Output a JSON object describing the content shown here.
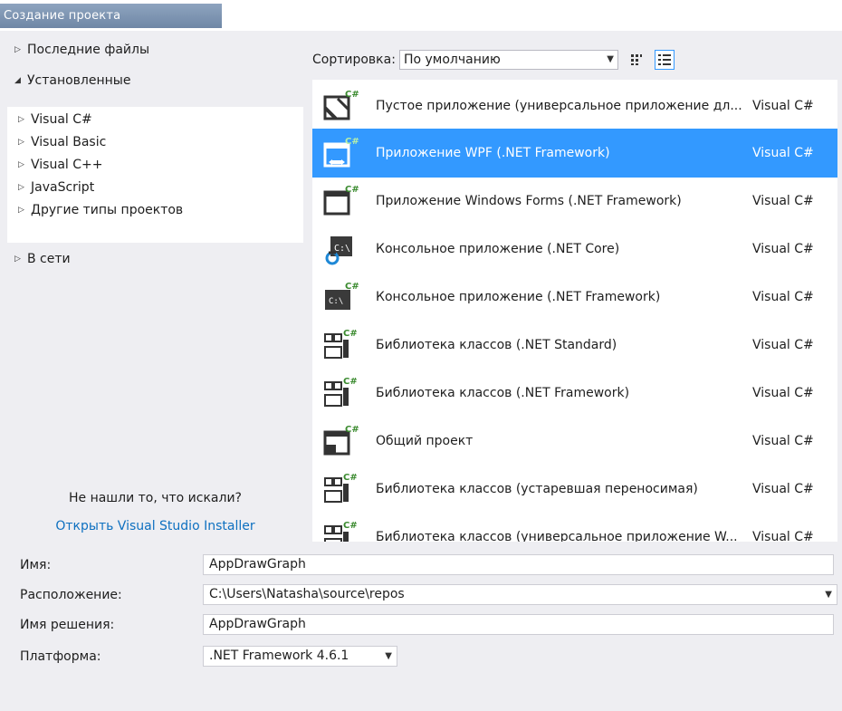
{
  "window": {
    "title": "Создание проекта"
  },
  "tree": {
    "recent": "Последние файлы",
    "installed": "Установленные",
    "languages": [
      "Visual C#",
      "Visual Basic",
      "Visual C++",
      "JavaScript",
      "Другие типы проектов"
    ],
    "online": "В сети"
  },
  "help": {
    "text": "Не нашли то, что искали?",
    "link": "Открыть Visual Studio Installer"
  },
  "sort": {
    "label": "Сортировка:",
    "value": "По умолчанию"
  },
  "templates": [
    {
      "name": "Пустое приложение (универсальное приложение дл...",
      "lang": "Visual C#",
      "icon": "blank-app-icon"
    },
    {
      "name": "Приложение WPF (.NET Framework)",
      "lang": "Visual C#",
      "icon": "wpf-app-icon",
      "selected": true
    },
    {
      "name": "Приложение Windows Forms (.NET Framework)",
      "lang": "Visual C#",
      "icon": "winforms-app-icon"
    },
    {
      "name": "Консольное приложение (.NET Core)",
      "lang": "Visual C#",
      "icon": "console-core-icon"
    },
    {
      "name": "Консольное приложение (.NET Framework)",
      "lang": "Visual C#",
      "icon": "console-framework-icon"
    },
    {
      "name": "Библиотека классов (.NET Standard)",
      "lang": "Visual C#",
      "icon": "class-library-icon"
    },
    {
      "name": "Библиотека классов (.NET Framework)",
      "lang": "Visual C#",
      "icon": "class-library-icon"
    },
    {
      "name": "Общий проект",
      "lang": "Visual C#",
      "icon": "shared-project-icon"
    },
    {
      "name": "Библиотека классов (устаревшая переносимая)",
      "lang": "Visual C#",
      "icon": "class-library-icon"
    },
    {
      "name": "Библиотека классов (универсальное приложение W...",
      "lang": "Visual C#",
      "icon": "class-library-icon"
    }
  ],
  "form": {
    "name_label": "Имя:",
    "name_value": "AppDrawGraph",
    "location_label": "Расположение:",
    "location_value": "C:\\Users\\Natasha\\source\\repos",
    "solution_label": "Имя решения:",
    "solution_value": "AppDrawGraph",
    "platform_label": "Платформа:",
    "platform_value": ".NET Framework 4.6.1"
  },
  "colors": {
    "selection": "#3399ff",
    "link": "#0e70c0",
    "title_bar": "#7a91ad"
  }
}
